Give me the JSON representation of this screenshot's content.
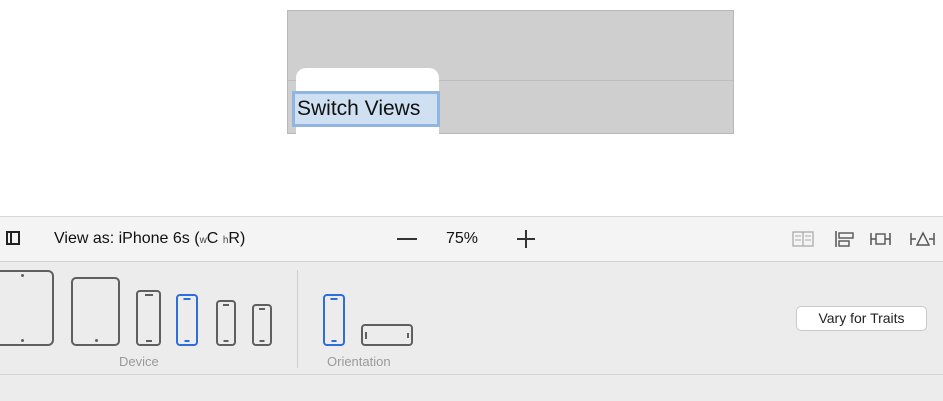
{
  "canvas": {
    "selected_label_text": "Switch Views"
  },
  "toolbar": {
    "view_as_prefix": "View as: iPhone 6s (",
    "size_class_w": "w",
    "size_class_w_value": "C",
    "size_class_h": "h",
    "size_class_h_value": "R",
    "view_as_suffix": ")",
    "zoom_level": "75%",
    "icons": [
      "embed-stack-icon",
      "align-icon",
      "pin-icon",
      "resolve-issues-icon"
    ]
  },
  "device_panel": {
    "device_label": "Device",
    "orientation_label": "Orientation",
    "vary_button_label": "Vary for Traits",
    "selected_device_index": 4,
    "selected_orientation": "portrait",
    "colors": {
      "selected": "#2d6edb",
      "unselected": "#5f5f5f"
    }
  }
}
